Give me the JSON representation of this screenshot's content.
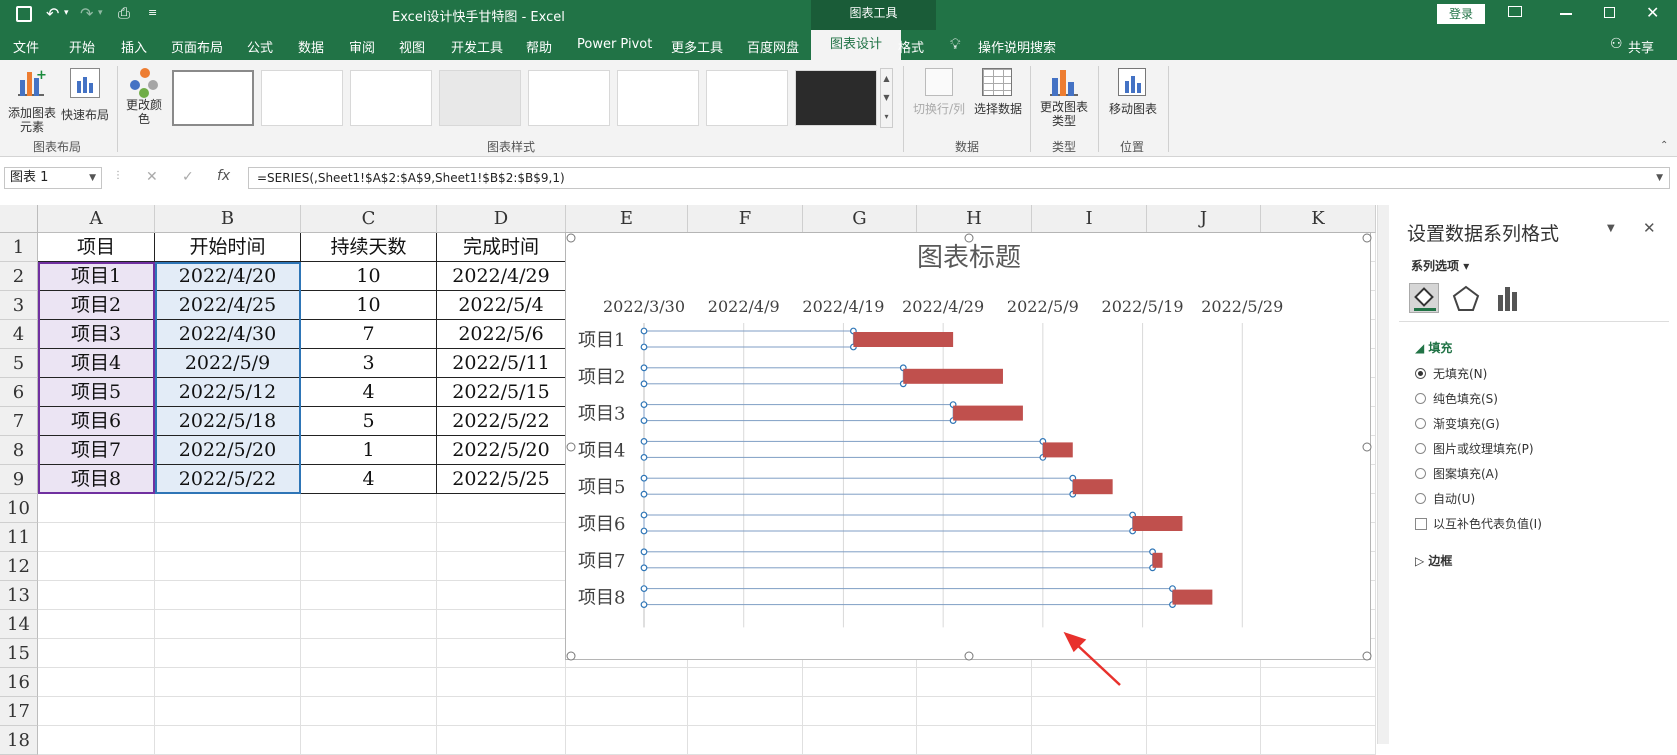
{
  "window": {
    "title": "Excel设计快手甘特图  -  Excel",
    "context_tab": "图表工具",
    "login": "登录"
  },
  "tabs": [
    "文件",
    "开始",
    "插入",
    "页面布局",
    "公式",
    "数据",
    "审阅",
    "视图",
    "开发工具",
    "帮助",
    "Power Pivot",
    "更多工具",
    "百度网盘",
    "图表设计",
    "格式"
  ],
  "active_tab": "图表设计",
  "tell_me": "操作说明搜索",
  "share": "共享",
  "ribbon": {
    "add_element": "添加图表元素",
    "quick_layout": "快速布局",
    "change_colors": "更改颜色",
    "switch_rowcol": "切换行/列",
    "select_data": "选择数据",
    "change_type": "更改图表类型",
    "move_chart": "移动图表",
    "group_layout": "图表布局",
    "group_styles": "图表样式",
    "group_data": "数据",
    "group_type": "类型",
    "group_location": "位置"
  },
  "name_box": "图表 1",
  "formula": "=SERIES(,Sheet1!$A$2:$A$9,Sheet1!$B$2:$B$9,1)",
  "columns": [
    "A",
    "B",
    "C",
    "D",
    "E",
    "F",
    "G",
    "H",
    "I",
    "J",
    "K"
  ],
  "rows": [
    "1",
    "2",
    "3",
    "4",
    "5",
    "6",
    "7",
    "8",
    "9",
    "10",
    "11",
    "12",
    "13",
    "14",
    "15",
    "16",
    "17",
    "18"
  ],
  "table": {
    "headers": [
      "项目",
      "开始时间",
      "持续天数",
      "完成时间"
    ],
    "rows": [
      [
        "项目1",
        "2022/4/20",
        "10",
        "2022/4/29"
      ],
      [
        "项目2",
        "2022/4/25",
        "10",
        "2022/5/4"
      ],
      [
        "项目3",
        "2022/4/30",
        "7",
        "2022/5/6"
      ],
      [
        "项目4",
        "2022/5/9",
        "3",
        "2022/5/11"
      ],
      [
        "项目5",
        "2022/5/12",
        "4",
        "2022/5/15"
      ],
      [
        "项目6",
        "2022/5/18",
        "5",
        "2022/5/22"
      ],
      [
        "项目7",
        "2022/5/20",
        "1",
        "2022/5/20"
      ],
      [
        "项目8",
        "2022/5/22",
        "4",
        "2022/5/25"
      ]
    ]
  },
  "chart_data": {
    "type": "bar",
    "title": "图表标题",
    "categories": [
      "项目1",
      "项目2",
      "项目3",
      "项目4",
      "项目5",
      "项目6",
      "项目7",
      "项目8"
    ],
    "x_ticks": [
      "2022/3/30",
      "2022/4/9",
      "2022/4/19",
      "2022/4/29",
      "2022/5/9",
      "2022/5/19",
      "2022/5/29"
    ],
    "xlim": [
      "2022/3/30",
      "2022/6/8"
    ],
    "stacked": true,
    "series": [
      {
        "values": [
          "2022/4/20",
          "2022/4/25",
          "2022/4/30",
          "2022/5/9",
          "2022/5/12",
          "2022/5/18",
          "2022/5/20",
          "2022/5/22"
        ],
        "fill": "none"
      },
      {
        "values": [
          10,
          10,
          7,
          3,
          4,
          5,
          1,
          4
        ],
        "color": "#c0504d"
      }
    ],
    "grid": true
  },
  "pane": {
    "title": "设置数据系列格式",
    "series_options": "系列选项",
    "fill_section": "填充",
    "options": [
      "无填充(N)",
      "纯色填充(S)",
      "渐变填充(G)",
      "图片或纹理填充(P)",
      "图案填充(A)",
      "自动(U)"
    ],
    "selected_option": "无填充(N)",
    "invert": "以互补色代表负值(I)",
    "border_section": "边框"
  },
  "colors": {
    "excel_green": "#217346",
    "bar": "#c0504d",
    "arrow": "#e8312c"
  }
}
